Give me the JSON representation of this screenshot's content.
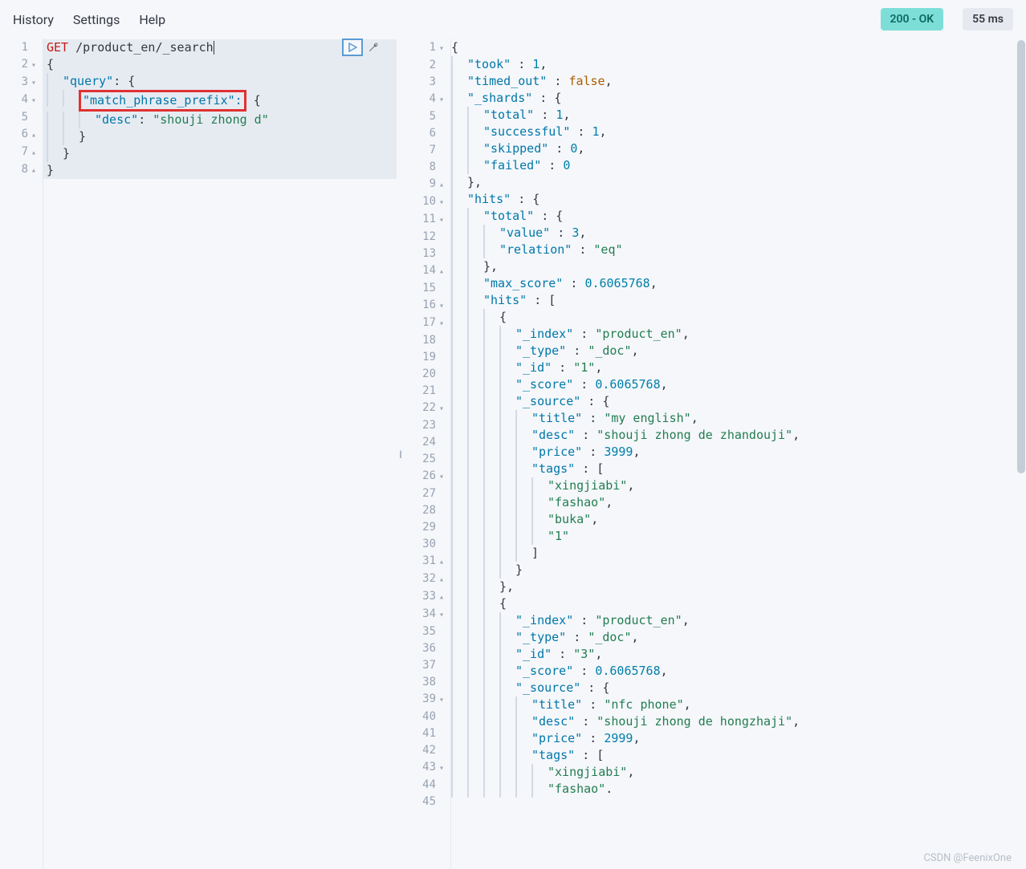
{
  "toolbar": {
    "history": "History",
    "settings": "Settings",
    "help": "Help",
    "status": "200 - OK",
    "time": "55 ms"
  },
  "editor": {
    "lines": [
      {
        "n": "1",
        "fold": "",
        "method": "GET",
        "path": "/product_en/_search"
      },
      {
        "n": "2",
        "fold": "▾",
        "text": "{"
      },
      {
        "n": "3",
        "fold": "▾",
        "indent": 1,
        "key": "\"query\"",
        "after": ": {",
        "bar": true
      },
      {
        "n": "4",
        "fold": "▾",
        "indent": 2,
        "redkey": "\"match_phrase_prefix\":",
        "after": " {",
        "bar": true
      },
      {
        "n": "5",
        "fold": "",
        "indent": 3,
        "key": "\"desc\"",
        "colon": ": ",
        "val": "\"shouji zhong d\"",
        "bar": true
      },
      {
        "n": "6",
        "fold": "▴",
        "indent": 2,
        "text": "}",
        "bar": true
      },
      {
        "n": "7",
        "fold": "▴",
        "indent": 1,
        "text": "}",
        "bar": true
      },
      {
        "n": "8",
        "fold": "▴",
        "text": "}"
      }
    ]
  },
  "response": {
    "lines": [
      {
        "n": "1",
        "fold": "▾",
        "indent": 0,
        "tokens": [
          {
            "t": "p",
            "v": "{"
          }
        ]
      },
      {
        "n": "2",
        "fold": "",
        "indent": 1,
        "tokens": [
          {
            "t": "k",
            "v": "\"took\""
          },
          {
            "t": "p",
            "v": " : "
          },
          {
            "t": "n",
            "v": "1"
          },
          {
            "t": "p",
            "v": ","
          }
        ]
      },
      {
        "n": "3",
        "fold": "",
        "indent": 1,
        "tokens": [
          {
            "t": "k",
            "v": "\"timed_out\""
          },
          {
            "t": "p",
            "v": " : "
          },
          {
            "t": "b",
            "v": "false"
          },
          {
            "t": "p",
            "v": ","
          }
        ]
      },
      {
        "n": "4",
        "fold": "▾",
        "indent": 1,
        "tokens": [
          {
            "t": "k",
            "v": "\"_shards\""
          },
          {
            "t": "p",
            "v": " : {"
          }
        ]
      },
      {
        "n": "5",
        "fold": "",
        "indent": 2,
        "tokens": [
          {
            "t": "k",
            "v": "\"total\""
          },
          {
            "t": "p",
            "v": " : "
          },
          {
            "t": "n",
            "v": "1"
          },
          {
            "t": "p",
            "v": ","
          }
        ]
      },
      {
        "n": "6",
        "fold": "",
        "indent": 2,
        "tokens": [
          {
            "t": "k",
            "v": "\"successful\""
          },
          {
            "t": "p",
            "v": " : "
          },
          {
            "t": "n",
            "v": "1"
          },
          {
            "t": "p",
            "v": ","
          }
        ]
      },
      {
        "n": "7",
        "fold": "",
        "indent": 2,
        "tokens": [
          {
            "t": "k",
            "v": "\"skipped\""
          },
          {
            "t": "p",
            "v": " : "
          },
          {
            "t": "n",
            "v": "0"
          },
          {
            "t": "p",
            "v": ","
          }
        ]
      },
      {
        "n": "8",
        "fold": "",
        "indent": 2,
        "tokens": [
          {
            "t": "k",
            "v": "\"failed\""
          },
          {
            "t": "p",
            "v": " : "
          },
          {
            "t": "n",
            "v": "0"
          }
        ]
      },
      {
        "n": "9",
        "fold": "▴",
        "indent": 1,
        "tokens": [
          {
            "t": "p",
            "v": "},"
          }
        ]
      },
      {
        "n": "10",
        "fold": "▾",
        "indent": 1,
        "tokens": [
          {
            "t": "k",
            "v": "\"hits\""
          },
          {
            "t": "p",
            "v": " : {"
          }
        ]
      },
      {
        "n": "11",
        "fold": "▾",
        "indent": 2,
        "tokens": [
          {
            "t": "k",
            "v": "\"total\""
          },
          {
            "t": "p",
            "v": " : {"
          }
        ]
      },
      {
        "n": "12",
        "fold": "",
        "indent": 3,
        "tokens": [
          {
            "t": "k",
            "v": "\"value\""
          },
          {
            "t": "p",
            "v": " : "
          },
          {
            "t": "n",
            "v": "3"
          },
          {
            "t": "p",
            "v": ","
          }
        ]
      },
      {
        "n": "13",
        "fold": "",
        "indent": 3,
        "tokens": [
          {
            "t": "k",
            "v": "\"relation\""
          },
          {
            "t": "p",
            "v": " : "
          },
          {
            "t": "s",
            "v": "\"eq\""
          }
        ]
      },
      {
        "n": "14",
        "fold": "▴",
        "indent": 2,
        "tokens": [
          {
            "t": "p",
            "v": "},"
          }
        ]
      },
      {
        "n": "15",
        "fold": "",
        "indent": 2,
        "tokens": [
          {
            "t": "k",
            "v": "\"max_score\""
          },
          {
            "t": "p",
            "v": " : "
          },
          {
            "t": "n",
            "v": "0.6065768"
          },
          {
            "t": "p",
            "v": ","
          }
        ]
      },
      {
        "n": "16",
        "fold": "▾",
        "indent": 2,
        "tokens": [
          {
            "t": "k",
            "v": "\"hits\""
          },
          {
            "t": "p",
            "v": " : ["
          }
        ]
      },
      {
        "n": "17",
        "fold": "▾",
        "indent": 3,
        "tokens": [
          {
            "t": "p",
            "v": "{"
          }
        ]
      },
      {
        "n": "18",
        "fold": "",
        "indent": 4,
        "tokens": [
          {
            "t": "k",
            "v": "\"_index\""
          },
          {
            "t": "p",
            "v": " : "
          },
          {
            "t": "s",
            "v": "\"product_en\""
          },
          {
            "t": "p",
            "v": ","
          }
        ]
      },
      {
        "n": "19",
        "fold": "",
        "indent": 4,
        "tokens": [
          {
            "t": "k",
            "v": "\"_type\""
          },
          {
            "t": "p",
            "v": " : "
          },
          {
            "t": "s",
            "v": "\"_doc\""
          },
          {
            "t": "p",
            "v": ","
          }
        ]
      },
      {
        "n": "20",
        "fold": "",
        "indent": 4,
        "tokens": [
          {
            "t": "k",
            "v": "\"_id\""
          },
          {
            "t": "p",
            "v": " : "
          },
          {
            "t": "s",
            "v": "\"1\""
          },
          {
            "t": "p",
            "v": ","
          }
        ]
      },
      {
        "n": "21",
        "fold": "",
        "indent": 4,
        "tokens": [
          {
            "t": "k",
            "v": "\"_score\""
          },
          {
            "t": "p",
            "v": " : "
          },
          {
            "t": "n",
            "v": "0.6065768"
          },
          {
            "t": "p",
            "v": ","
          }
        ]
      },
      {
        "n": "22",
        "fold": "▾",
        "indent": 4,
        "tokens": [
          {
            "t": "k",
            "v": "\"_source\""
          },
          {
            "t": "p",
            "v": " : {"
          }
        ]
      },
      {
        "n": "23",
        "fold": "",
        "indent": 5,
        "tokens": [
          {
            "t": "k",
            "v": "\"title\""
          },
          {
            "t": "p",
            "v": " : "
          },
          {
            "t": "s",
            "v": "\"my english\""
          },
          {
            "t": "p",
            "v": ","
          }
        ]
      },
      {
        "n": "24",
        "fold": "",
        "indent": 5,
        "tokens": [
          {
            "t": "k",
            "v": "\"desc\""
          },
          {
            "t": "p",
            "v": " : "
          },
          {
            "t": "s",
            "v": "\"shouji zhong de zhandouji\""
          },
          {
            "t": "p",
            "v": ","
          }
        ]
      },
      {
        "n": "25",
        "fold": "",
        "indent": 5,
        "tokens": [
          {
            "t": "k",
            "v": "\"price\""
          },
          {
            "t": "p",
            "v": " : "
          },
          {
            "t": "n",
            "v": "3999"
          },
          {
            "t": "p",
            "v": ","
          }
        ]
      },
      {
        "n": "26",
        "fold": "▾",
        "indent": 5,
        "tokens": [
          {
            "t": "k",
            "v": "\"tags\""
          },
          {
            "t": "p",
            "v": " : ["
          }
        ]
      },
      {
        "n": "27",
        "fold": "",
        "indent": 6,
        "tokens": [
          {
            "t": "s",
            "v": "\"xingjiabi\""
          },
          {
            "t": "p",
            "v": ","
          }
        ]
      },
      {
        "n": "28",
        "fold": "",
        "indent": 6,
        "tokens": [
          {
            "t": "s",
            "v": "\"fashao\""
          },
          {
            "t": "p",
            "v": ","
          }
        ]
      },
      {
        "n": "29",
        "fold": "",
        "indent": 6,
        "tokens": [
          {
            "t": "s",
            "v": "\"buka\""
          },
          {
            "t": "p",
            "v": ","
          }
        ]
      },
      {
        "n": "30",
        "fold": "",
        "indent": 6,
        "tokens": [
          {
            "t": "s",
            "v": "\"1\""
          }
        ]
      },
      {
        "n": "31",
        "fold": "▴",
        "indent": 5,
        "tokens": [
          {
            "t": "p",
            "v": "]"
          }
        ]
      },
      {
        "n": "32",
        "fold": "▴",
        "indent": 4,
        "tokens": [
          {
            "t": "p",
            "v": "}"
          }
        ]
      },
      {
        "n": "33",
        "fold": "▴",
        "indent": 3,
        "tokens": [
          {
            "t": "p",
            "v": "},"
          }
        ]
      },
      {
        "n": "34",
        "fold": "▾",
        "indent": 3,
        "tokens": [
          {
            "t": "p",
            "v": "{"
          }
        ]
      },
      {
        "n": "35",
        "fold": "",
        "indent": 4,
        "tokens": [
          {
            "t": "k",
            "v": "\"_index\""
          },
          {
            "t": "p",
            "v": " : "
          },
          {
            "t": "s",
            "v": "\"product_en\""
          },
          {
            "t": "p",
            "v": ","
          }
        ]
      },
      {
        "n": "36",
        "fold": "",
        "indent": 4,
        "tokens": [
          {
            "t": "k",
            "v": "\"_type\""
          },
          {
            "t": "p",
            "v": " : "
          },
          {
            "t": "s",
            "v": "\"_doc\""
          },
          {
            "t": "p",
            "v": ","
          }
        ]
      },
      {
        "n": "37",
        "fold": "",
        "indent": 4,
        "tokens": [
          {
            "t": "k",
            "v": "\"_id\""
          },
          {
            "t": "p",
            "v": " : "
          },
          {
            "t": "s",
            "v": "\"3\""
          },
          {
            "t": "p",
            "v": ","
          }
        ]
      },
      {
        "n": "38",
        "fold": "",
        "indent": 4,
        "tokens": [
          {
            "t": "k",
            "v": "\"_score\""
          },
          {
            "t": "p",
            "v": " : "
          },
          {
            "t": "n",
            "v": "0.6065768"
          },
          {
            "t": "p",
            "v": ","
          }
        ]
      },
      {
        "n": "39",
        "fold": "▾",
        "indent": 4,
        "tokens": [
          {
            "t": "k",
            "v": "\"_source\""
          },
          {
            "t": "p",
            "v": " : {"
          }
        ]
      },
      {
        "n": "40",
        "fold": "",
        "indent": 5,
        "tokens": [
          {
            "t": "k",
            "v": "\"title\""
          },
          {
            "t": "p",
            "v": " : "
          },
          {
            "t": "s",
            "v": "\"nfc phone\""
          },
          {
            "t": "p",
            "v": ","
          }
        ]
      },
      {
        "n": "41",
        "fold": "",
        "indent": 5,
        "tokens": [
          {
            "t": "k",
            "v": "\"desc\""
          },
          {
            "t": "p",
            "v": " : "
          },
          {
            "t": "s",
            "v": "\"shouji zhong de hongzhaji\""
          },
          {
            "t": "p",
            "v": ","
          }
        ]
      },
      {
        "n": "42",
        "fold": "",
        "indent": 5,
        "tokens": [
          {
            "t": "k",
            "v": "\"price\""
          },
          {
            "t": "p",
            "v": " : "
          },
          {
            "t": "n",
            "v": "2999"
          },
          {
            "t": "p",
            "v": ","
          }
        ]
      },
      {
        "n": "43",
        "fold": "▾",
        "indent": 5,
        "tokens": [
          {
            "t": "k",
            "v": "\"tags\""
          },
          {
            "t": "p",
            "v": " : ["
          }
        ]
      },
      {
        "n": "44",
        "fold": "",
        "indent": 6,
        "tokens": [
          {
            "t": "s",
            "v": "\"xingjiabi\""
          },
          {
            "t": "p",
            "v": ","
          }
        ]
      },
      {
        "n": "45",
        "fold": "",
        "indent": 6,
        "tokens": [
          {
            "t": "s",
            "v": "\"fashao\""
          },
          {
            "t": "p",
            "v": "."
          }
        ]
      }
    ]
  },
  "watermark": "CSDN @FeenixOne"
}
